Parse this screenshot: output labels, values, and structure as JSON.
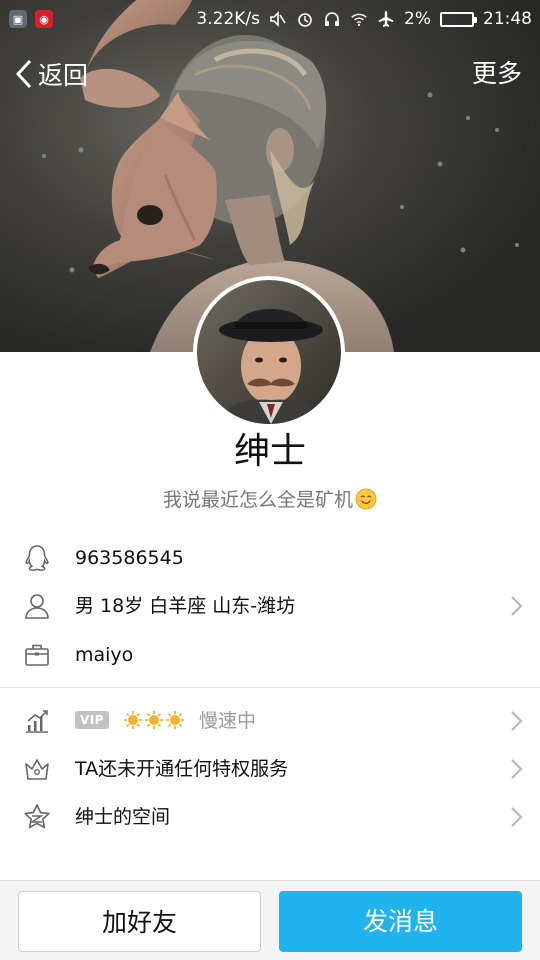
{
  "status_bar": {
    "speed": "3.22K/s",
    "battery_percent": "2%",
    "battery_level": 0.98,
    "time": "21:48",
    "left_icons": [
      "photo-app-icon",
      "netease-music-icon"
    ],
    "right_icons": [
      "mute-icon",
      "alarm-icon",
      "headphones-icon",
      "wifi-icon",
      "airplane-icon",
      "battery-icon"
    ]
  },
  "nav": {
    "back_label": "返回",
    "more_label": "更多"
  },
  "profile": {
    "nickname": "绅士",
    "signature": "我说最近怎么全是矿机"
  },
  "info": {
    "qq_number": "963586545",
    "personal": "男  18岁  白羊座  山东-潍坊",
    "company": "maiyo"
  },
  "privileges": {
    "vip_badge": "VIP",
    "speed_status": "慢速中",
    "service_text": "TA还未开通任何特权服务",
    "space_text": "绅士的空间"
  },
  "actions": {
    "add_friend_label": "加好友",
    "send_message_label": "发消息"
  },
  "colors": {
    "accent": "#20b3ee",
    "battery_fill": "#4cd964"
  }
}
